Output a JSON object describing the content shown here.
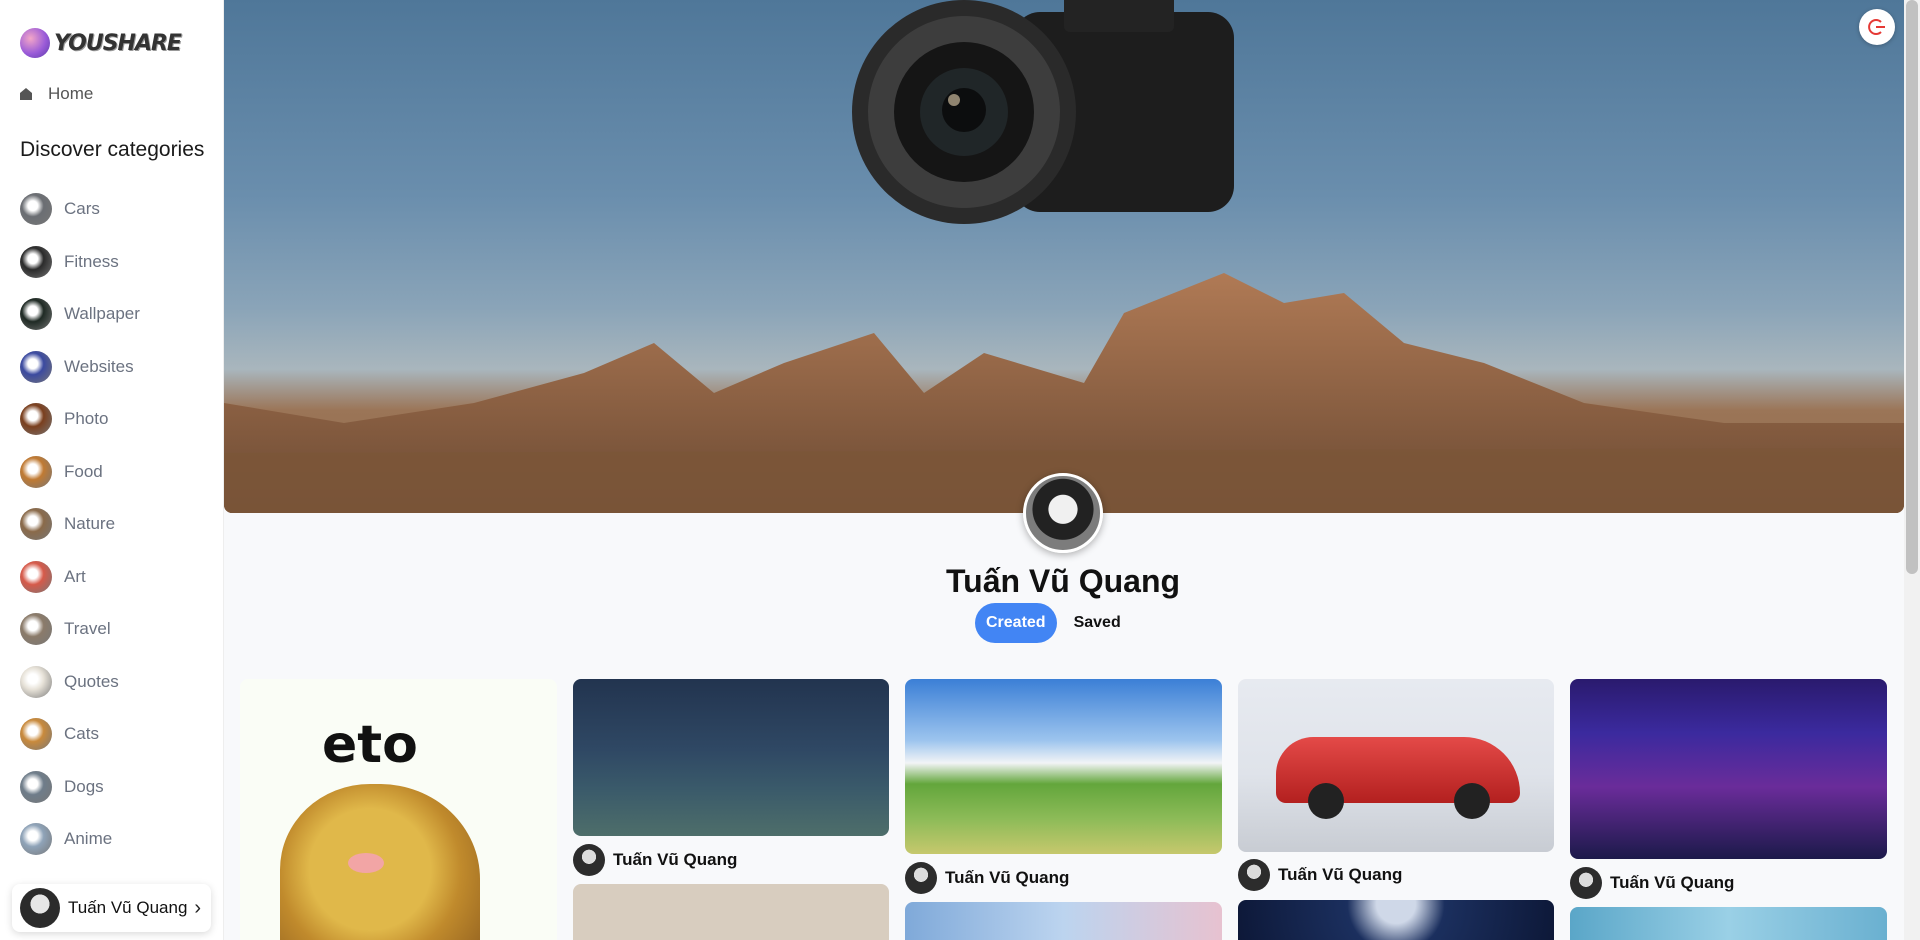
{
  "app": {
    "logo_text": "YOUSHARE"
  },
  "sidebar": {
    "home_label": "Home",
    "section_title": "Discover categories",
    "categories": [
      {
        "label": "Cars",
        "color": "#6b6e73"
      },
      {
        "label": "Fitness",
        "color": "#2b2b2b"
      },
      {
        "label": "Wallpaper",
        "color": "#1f2a24"
      },
      {
        "label": "Websites",
        "color": "#3b4aa0"
      },
      {
        "label": "Photo",
        "color": "#7a3f1e"
      },
      {
        "label": "Food",
        "color": "#c07a33"
      },
      {
        "label": "Nature",
        "color": "#8a6a4a"
      },
      {
        "label": "Art",
        "color": "#d65a4a"
      },
      {
        "label": "Travel",
        "color": "#8b7b6a"
      },
      {
        "label": "Quotes",
        "color": "#e7e2d8"
      },
      {
        "label": "Cats",
        "color": "#c98a3c"
      },
      {
        "label": "Dogs",
        "color": "#6f7d8a"
      },
      {
        "label": "Anime",
        "color": "#8fa3b8"
      }
    ],
    "user": {
      "name": "Tuấn Vũ Quang",
      "arrow": "›"
    }
  },
  "profile": {
    "name": "Tuấn Vũ Quang",
    "tabs": {
      "created": "Created",
      "saved": "Saved"
    },
    "active_tab": "created"
  },
  "pins": [
    {
      "caption": "eto",
      "author": ""
    },
    {
      "author": "Tuấn Vũ Quang"
    },
    {
      "author": "Tuấn Vũ Quang"
    },
    {
      "author": "Tuấn Vũ Quang"
    },
    {
      "author": "Tuấn Vũ Quang"
    }
  ],
  "colors": {
    "accent": "#4285f4",
    "logout_icon": "#e53935"
  },
  "icons": {
    "home": "home-icon",
    "logout": "logout-icon",
    "chevron": "chevron-right-icon"
  }
}
